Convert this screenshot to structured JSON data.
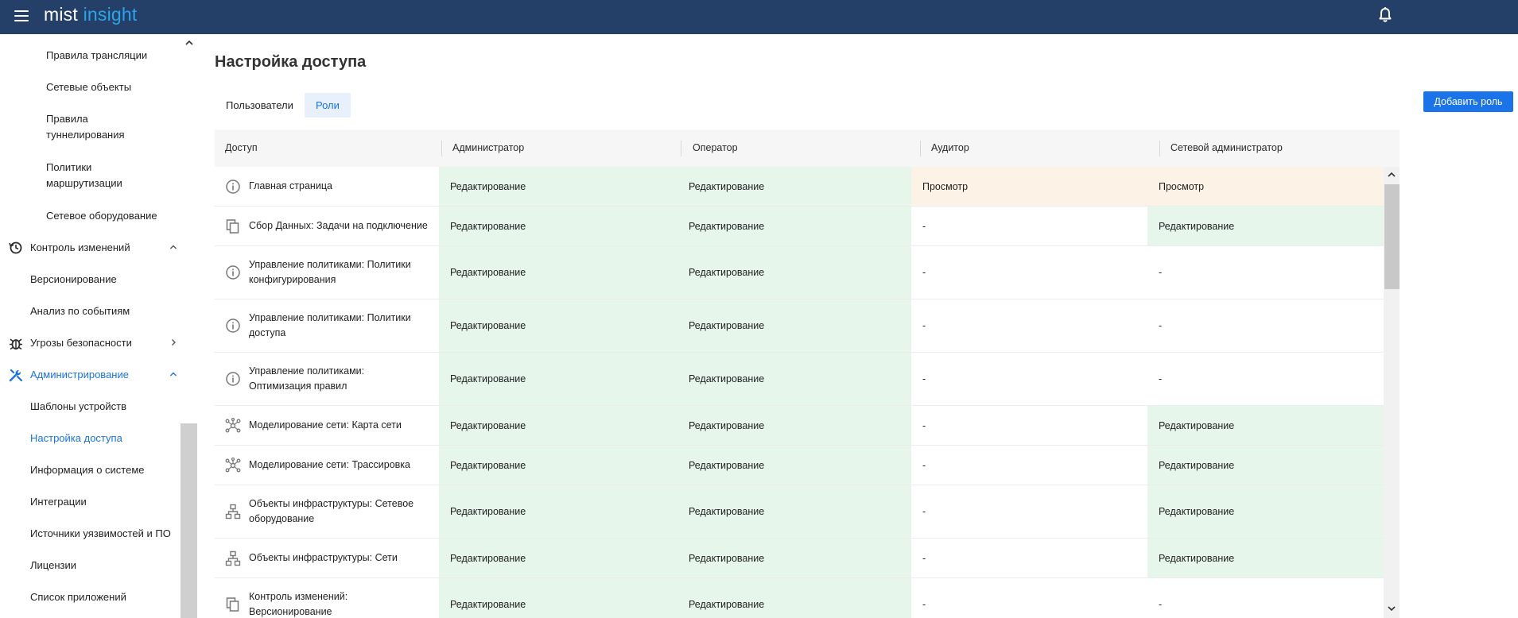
{
  "app": {
    "brand_main": "mist",
    "brand_accent": "insight"
  },
  "colors": {
    "topbar": "#244069",
    "accent": "#1a73e8",
    "brand_accent": "#2aa6e8",
    "edit_cell": "#e6f6ea",
    "view_cell": "#fdf2e6"
  },
  "sidebar": {
    "items": [
      {
        "label": "Правила трансляции"
      },
      {
        "label": "Сетевые объекты"
      },
      {
        "label": "Правила туннелирования"
      },
      {
        "label": "Политики маршрутизации"
      },
      {
        "label": "Сетевое оборудование"
      },
      {
        "label": "Контроль изменений",
        "icon": "history-icon"
      },
      {
        "label": "Версионирование"
      },
      {
        "label": "Анализ по событиям"
      },
      {
        "label": "Угрозы безопасности",
        "icon": "bug-icon"
      },
      {
        "label": "Администрирование",
        "icon": "tools-icon"
      },
      {
        "label": "Шаблоны устройств"
      },
      {
        "label": "Настройка доступа"
      },
      {
        "label": "Информация о системе"
      },
      {
        "label": "Интеграции"
      },
      {
        "label": "Источники уязвимостей и ПО"
      },
      {
        "label": "Лицензии"
      },
      {
        "label": "Список приложений"
      }
    ]
  },
  "main": {
    "title": "Настройка доступа",
    "tabs": [
      {
        "label": "Пользователи"
      },
      {
        "label": "Роли"
      }
    ],
    "add_role_label": "Добавить роль"
  },
  "table": {
    "headers": [
      "Доступ",
      "Администратор",
      "Оператор",
      "Аудитор",
      "Сетевой администратор"
    ],
    "rows": [
      {
        "icon": "info-icon",
        "access": "Главная страница",
        "admin": "Редактирование",
        "operator": "Редактирование",
        "auditor": "Просмотр",
        "netadmin": "Просмотр"
      },
      {
        "icon": "copy-icon",
        "access": "Сбор Данных: Задачи на подключение",
        "admin": "Редактирование",
        "operator": "Редактирование",
        "auditor": "-",
        "netadmin": "Редактирование"
      },
      {
        "icon": "info-icon",
        "access": "Управление политиками: Политики конфигурирования",
        "admin": "Редактирование",
        "operator": "Редактирование",
        "auditor": "-",
        "netadmin": "-"
      },
      {
        "icon": "info-icon",
        "access": "Управление политиками: Политики доступа",
        "admin": "Редактирование",
        "operator": "Редактирование",
        "auditor": "-",
        "netadmin": "-"
      },
      {
        "icon": "info-icon",
        "access": "Управление политиками: Оптимизация правил",
        "admin": "Редактирование",
        "operator": "Редактирование",
        "auditor": "-",
        "netadmin": "-"
      },
      {
        "icon": "network-map-icon",
        "access": "Моделирование сети: Карта сети",
        "admin": "Редактирование",
        "operator": "Редактирование",
        "auditor": "-",
        "netadmin": "Редактирование"
      },
      {
        "icon": "network-map-icon",
        "access": "Моделирование сети: Трассировка",
        "admin": "Редактирование",
        "operator": "Редактирование",
        "auditor": "-",
        "netadmin": "Редактирование"
      },
      {
        "icon": "hierarchy-icon",
        "access": "Объекты инфраструктуры: Сетевое оборудование",
        "admin": "Редактирование",
        "operator": "Редактирование",
        "auditor": "-",
        "netadmin": "Редактирование"
      },
      {
        "icon": "hierarchy-icon",
        "access": "Объекты инфраструктуры: Сети",
        "admin": "Редактирование",
        "operator": "Редактирование",
        "auditor": "-",
        "netadmin": "Редактирование"
      },
      {
        "icon": "copy-icon",
        "access": "Контроль изменений: Версионирование",
        "admin": "Редактирование",
        "operator": "Редактирование",
        "auditor": "-",
        "netadmin": "-"
      }
    ]
  }
}
